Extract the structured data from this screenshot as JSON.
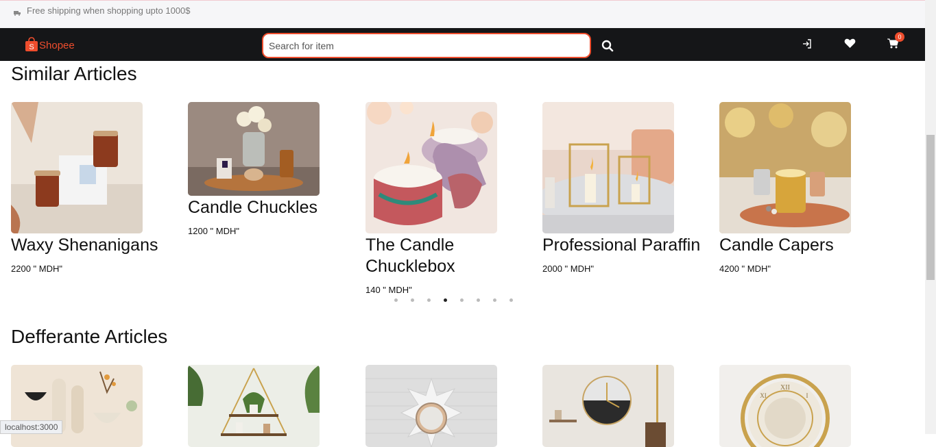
{
  "topbar": {
    "shipping_text": "Free shipping when shopping upto 1000$"
  },
  "navbar": {
    "logo_text": "Shopee",
    "search_placeholder": "Search for item",
    "cart_count": "0"
  },
  "similar": {
    "title": "Similar Articles",
    "items": [
      {
        "name": "Waxy Shenanigans",
        "price": "2200 \" MDH\""
      },
      {
        "name": "Candle Chuckles",
        "price": "1200 \" MDH\""
      },
      {
        "name": "The Candle Chucklebox",
        "price": "140 \" MDH\""
      },
      {
        "name": "Professional Paraffin",
        "price": "2000 \" MDH\""
      },
      {
        "name": "Candle Capers",
        "price": "4200 \" MDH\""
      }
    ],
    "carousel": {
      "dot_count": 8,
      "active_index": 3
    }
  },
  "different": {
    "title": "Defferante Articles"
  },
  "statusbar": {
    "url": "localhost:3000"
  }
}
